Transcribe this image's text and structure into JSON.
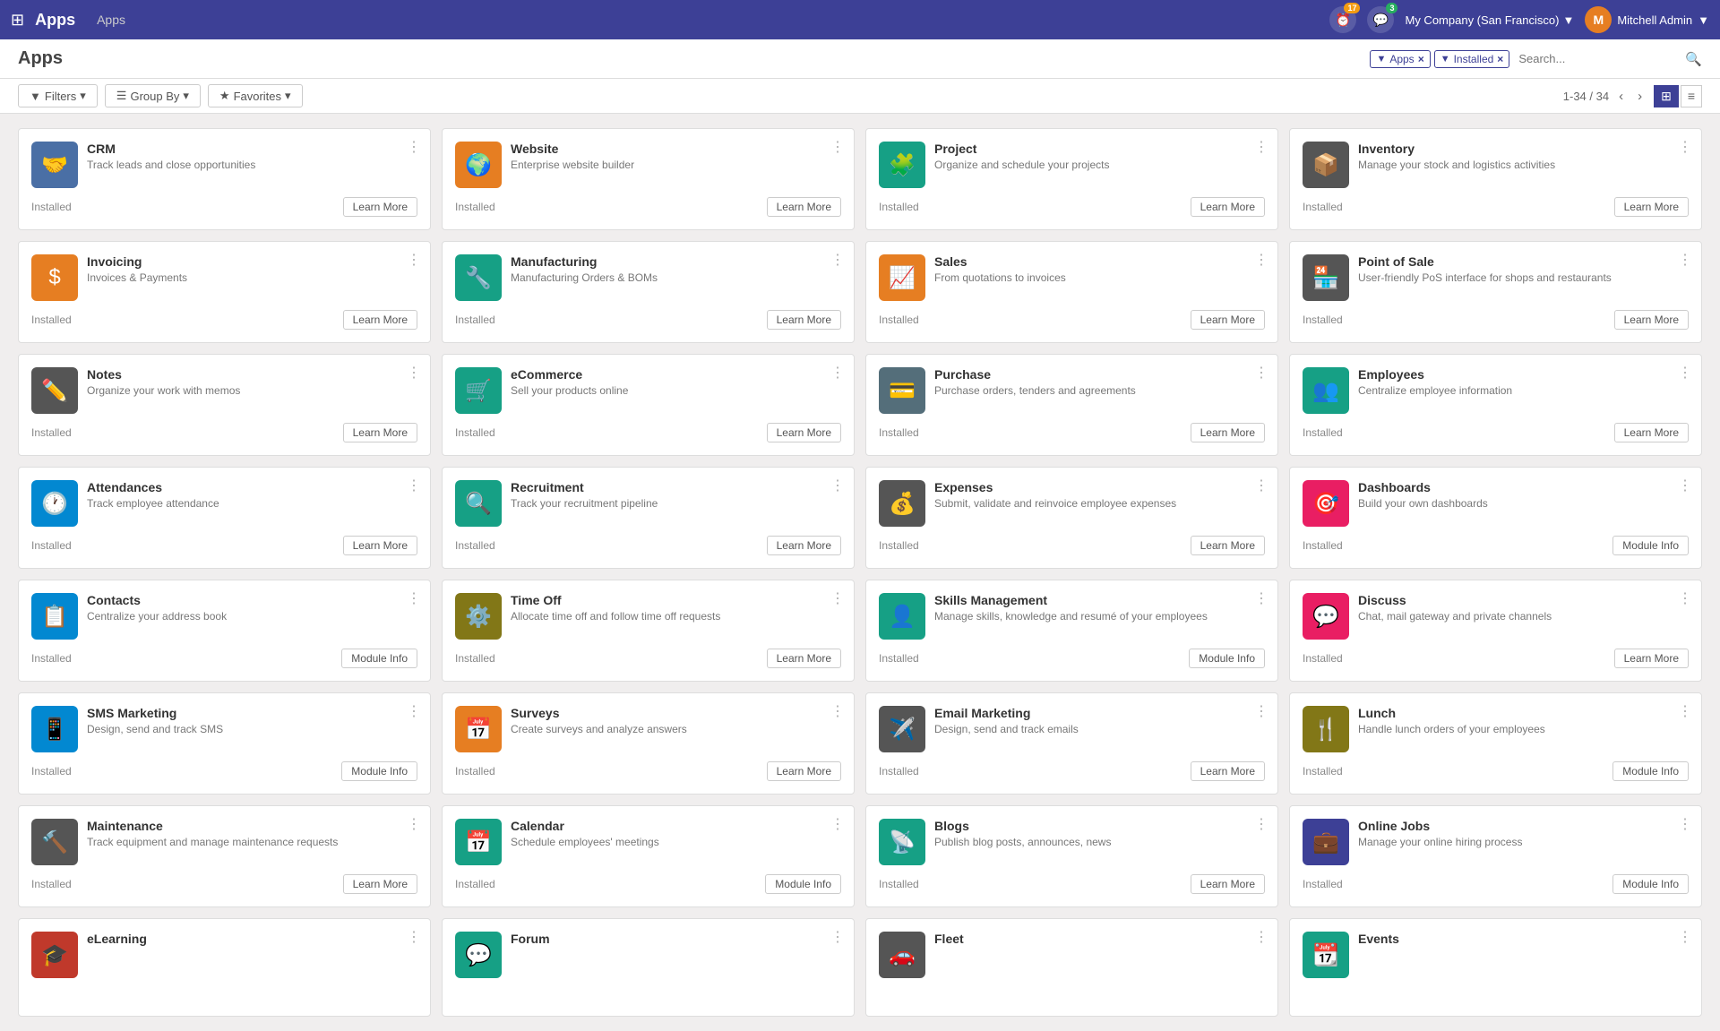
{
  "topnav": {
    "logo": "⊞",
    "appname": "Apps",
    "breadcrumb": "Apps",
    "notification1_count": "17",
    "notification2_count": "3",
    "company": "My Company (San Francisco)",
    "username": "Mitchell Admin"
  },
  "page": {
    "title": "Apps"
  },
  "filters": {
    "filter1_icon": "▼",
    "filter1_label": "Apps",
    "filter2_icon": "▼",
    "filter2_label": "Installed",
    "search_placeholder": "Search..."
  },
  "toolbar": {
    "filters_label": "Filters",
    "groupby_label": "Group By",
    "favorites_label": "Favorites",
    "pagination": "1-34 / 34",
    "view_grid": "⊞",
    "view_list": "≡"
  },
  "apps": [
    {
      "id": "crm",
      "name": "CRM",
      "desc": "Track leads and close opportunities",
      "status": "Installed",
      "btn": "Learn More",
      "icon": "🤝",
      "color": "ic-blue"
    },
    {
      "id": "website",
      "name": "Website",
      "desc": "Enterprise website builder",
      "status": "Installed",
      "btn": "Learn More",
      "icon": "🌍",
      "color": "ic-orange"
    },
    {
      "id": "project",
      "name": "Project",
      "desc": "Organize and schedule your projects",
      "status": "Installed",
      "btn": "Learn More",
      "icon": "🧩",
      "color": "ic-teal"
    },
    {
      "id": "inventory",
      "name": "Inventory",
      "desc": "Manage your stock and logistics activities",
      "status": "Installed",
      "btn": "Learn More",
      "icon": "📦",
      "color": "ic-darkgray"
    },
    {
      "id": "invoicing",
      "name": "Invoicing",
      "desc": "Invoices & Payments",
      "status": "Installed",
      "btn": "Learn More",
      "icon": "$",
      "color": "ic-orange"
    },
    {
      "id": "manufacturing",
      "name": "Manufacturing",
      "desc": "Manufacturing Orders & BOMs",
      "status": "Installed",
      "btn": "Learn More",
      "icon": "🔧",
      "color": "ic-teal"
    },
    {
      "id": "sales",
      "name": "Sales",
      "desc": "From quotations to invoices",
      "status": "Installed",
      "btn": "Learn More",
      "icon": "📈",
      "color": "ic-orange"
    },
    {
      "id": "pos",
      "name": "Point of Sale",
      "desc": "User-friendly PoS interface for shops and restaurants",
      "status": "Installed",
      "btn": "Learn More",
      "icon": "🏪",
      "color": "ic-darkgray"
    },
    {
      "id": "notes",
      "name": "Notes",
      "desc": "Organize your work with memos",
      "status": "Installed",
      "btn": "Learn More",
      "icon": "✏️",
      "color": "ic-darkgray"
    },
    {
      "id": "ecommerce",
      "name": "eCommerce",
      "desc": "Sell your products online",
      "status": "Installed",
      "btn": "Learn More",
      "icon": "🛒",
      "color": "ic-teal"
    },
    {
      "id": "purchase",
      "name": "Purchase",
      "desc": "Purchase orders, tenders and agreements",
      "status": "Installed",
      "btn": "Learn More",
      "icon": "💳",
      "color": "ic-bluegray"
    },
    {
      "id": "employees",
      "name": "Employees",
      "desc": "Centralize employee information",
      "status": "Installed",
      "btn": "Learn More",
      "icon": "👥",
      "color": "ic-teal"
    },
    {
      "id": "attendances",
      "name": "Attendances",
      "desc": "Track employee attendance",
      "status": "Installed",
      "btn": "Learn More",
      "icon": "🕐",
      "color": "ic-lightblue"
    },
    {
      "id": "recruitment",
      "name": "Recruitment",
      "desc": "Track your recruitment pipeline",
      "status": "Installed",
      "btn": "Learn More",
      "icon": "🔍",
      "color": "ic-teal"
    },
    {
      "id": "expenses",
      "name": "Expenses",
      "desc": "Submit, validate and reinvoice employee expenses",
      "status": "Installed",
      "btn": "Learn More",
      "icon": "💰",
      "color": "ic-darkgray"
    },
    {
      "id": "dashboards",
      "name": "Dashboards",
      "desc": "Build your own dashboards",
      "status": "Installed",
      "btn": "Module Info",
      "icon": "🎯",
      "color": "ic-pink"
    },
    {
      "id": "contacts",
      "name": "Contacts",
      "desc": "Centralize your address book",
      "status": "Installed",
      "btn": "Module Info",
      "icon": "📋",
      "color": "ic-lightblue"
    },
    {
      "id": "timeoff",
      "name": "Time Off",
      "desc": "Allocate time off and follow time off requests",
      "status": "Installed",
      "btn": "Learn More",
      "icon": "⚙️",
      "color": "ic-olive"
    },
    {
      "id": "skills",
      "name": "Skills Management",
      "desc": "Manage skills, knowledge and resumé of your employees",
      "status": "Installed",
      "btn": "Module Info",
      "icon": "👤",
      "color": "ic-teal"
    },
    {
      "id": "discuss",
      "name": "Discuss",
      "desc": "Chat, mail gateway and private channels",
      "status": "Installed",
      "btn": "Learn More",
      "icon": "💬",
      "color": "ic-pink"
    },
    {
      "id": "smsmarketing",
      "name": "SMS Marketing",
      "desc": "Design, send and track SMS",
      "status": "Installed",
      "btn": "Module Info",
      "icon": "📱",
      "color": "ic-lightblue"
    },
    {
      "id": "surveys",
      "name": "Surveys",
      "desc": "Create surveys and analyze answers",
      "status": "Installed",
      "btn": "Learn More",
      "icon": "📅",
      "color": "ic-orange"
    },
    {
      "id": "emailmarketing",
      "name": "Email Marketing",
      "desc": "Design, send and track emails",
      "status": "Installed",
      "btn": "Learn More",
      "icon": "✈️",
      "color": "ic-darkgray"
    },
    {
      "id": "lunch",
      "name": "Lunch",
      "desc": "Handle lunch orders of your employees",
      "status": "Installed",
      "btn": "Module Info",
      "icon": "🍴",
      "color": "ic-olive"
    },
    {
      "id": "maintenance",
      "name": "Maintenance",
      "desc": "Track equipment and manage maintenance requests",
      "status": "Installed",
      "btn": "Learn More",
      "icon": "🔨",
      "color": "ic-darkgray"
    },
    {
      "id": "calendar",
      "name": "Calendar",
      "desc": "Schedule employees' meetings",
      "status": "Installed",
      "btn": "Module Info",
      "icon": "📅",
      "color": "ic-teal"
    },
    {
      "id": "blogs",
      "name": "Blogs",
      "desc": "Publish blog posts, announces, news",
      "status": "Installed",
      "btn": "Learn More",
      "icon": "📡",
      "color": "ic-teal"
    },
    {
      "id": "onlinejobs",
      "name": "Online Jobs",
      "desc": "Manage your online hiring process",
      "status": "Installed",
      "btn": "Module Info",
      "icon": "💼",
      "color": "ic-indigo"
    },
    {
      "id": "elearning",
      "name": "eLearning",
      "desc": "",
      "status": "",
      "btn": "",
      "icon": "🎓",
      "color": "ic-red"
    },
    {
      "id": "forum",
      "name": "Forum",
      "desc": "",
      "status": "",
      "btn": "",
      "icon": "💬",
      "color": "ic-teal"
    },
    {
      "id": "fleet",
      "name": "Fleet",
      "desc": "",
      "status": "",
      "btn": "",
      "icon": "🚗",
      "color": "ic-darkgray"
    },
    {
      "id": "events",
      "name": "Events",
      "desc": "",
      "status": "",
      "btn": "",
      "icon": "📆",
      "color": "ic-teal"
    }
  ]
}
